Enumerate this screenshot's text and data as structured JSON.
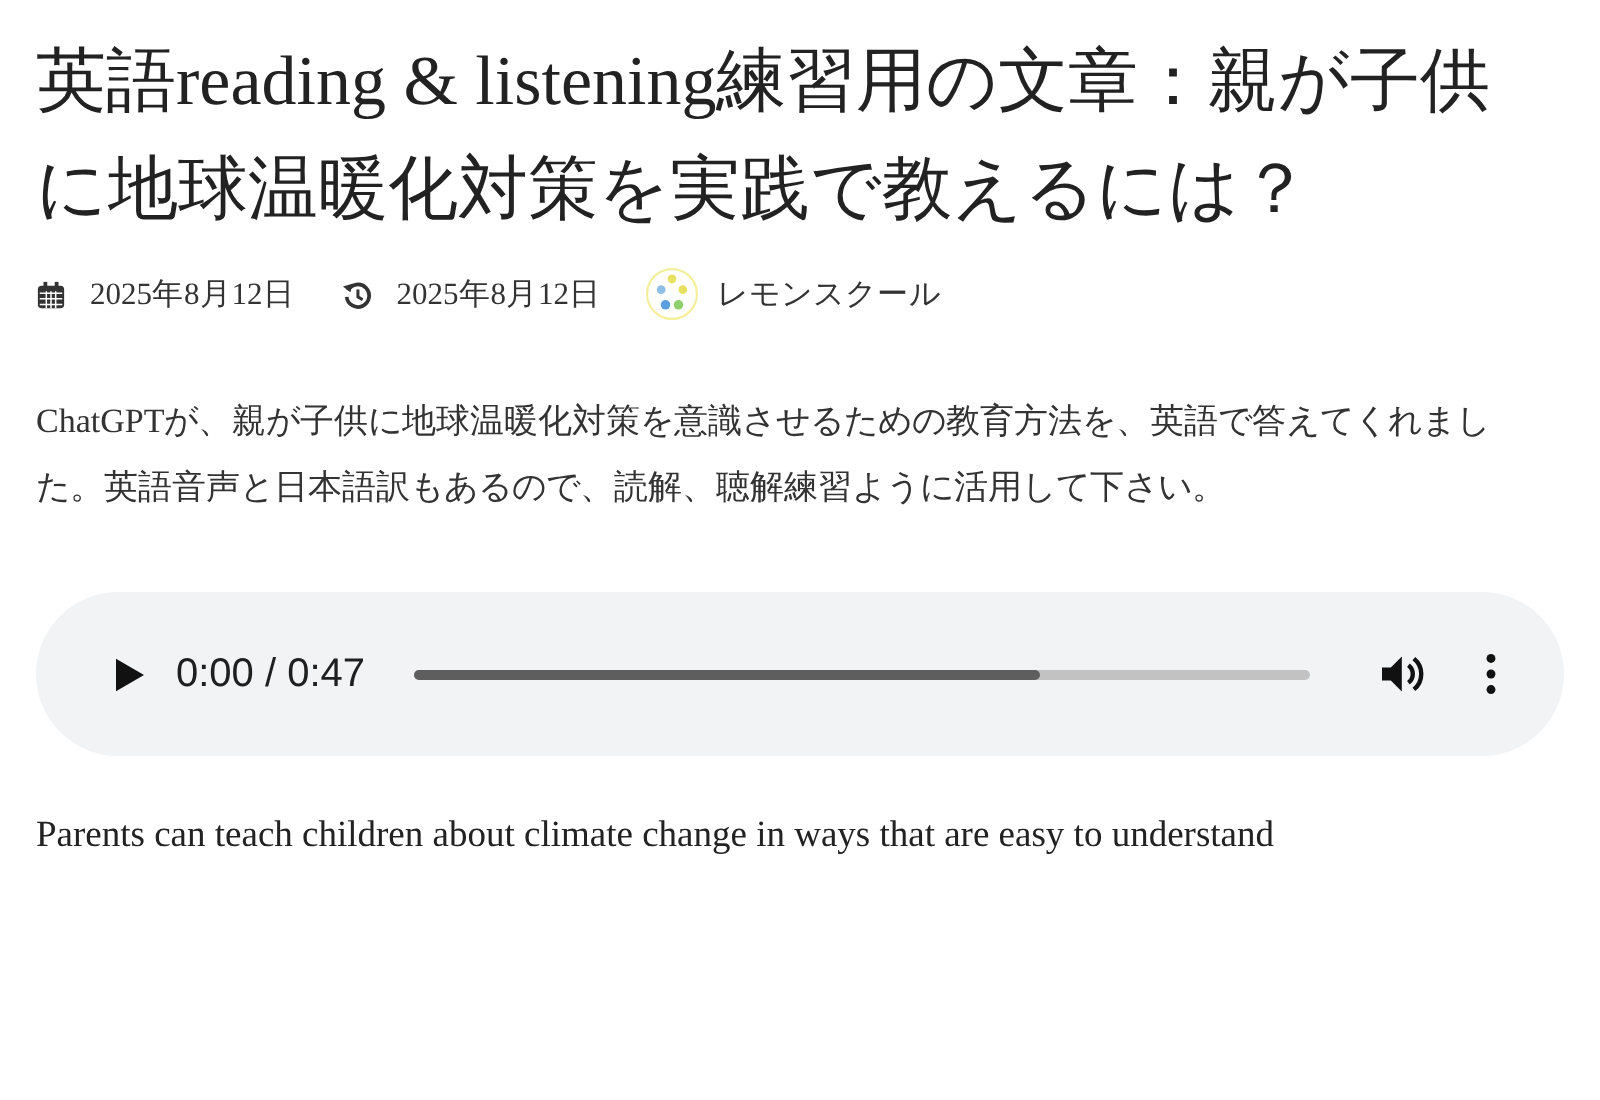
{
  "title": "英語reading & listening練習用の文章：親が子供に地球温暖化対策を実践で教えるには？",
  "meta": {
    "published": "2025年8月12日",
    "updated": "2025年8月12日",
    "author": "レモンスクール"
  },
  "intro": "ChatGPTが、親が子供に地球温暖化対策を意識させるための教育方法を、英語で答えてくれました。英語音声と日本語訳もあるので、読解、聴解練習ように活用して下さい。",
  "audio": {
    "time": "0:00 / 0:47",
    "level": 0.7
  },
  "body": "Parents can teach children about climate change in ways that are easy to understand"
}
